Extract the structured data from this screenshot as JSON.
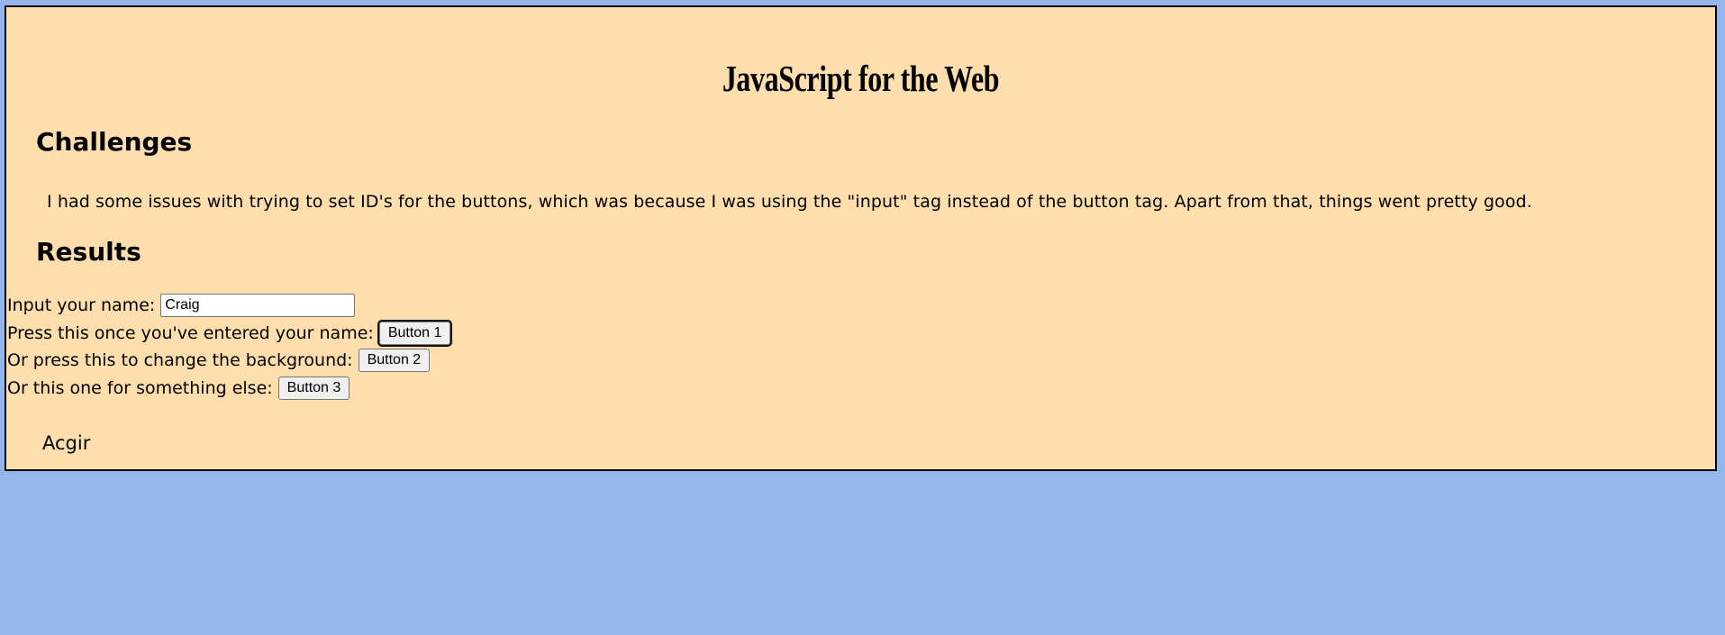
{
  "page": {
    "title": "JavaScript for the Web"
  },
  "challenges": {
    "heading": "Challenges",
    "text": "I had some issues with trying to set ID's for the buttons, which was because I was using the \"input\" tag instead of the button tag. Apart from that, things went pretty good."
  },
  "results": {
    "heading": "Results",
    "name_label": "Input your name:",
    "name_value": "Craig",
    "button1_label": "Press this once you've entered your name:",
    "button1_text": "Button 1",
    "button2_label": "Or press this to change the background:",
    "button2_text": "Button 2",
    "button3_label": "Or this one for something else:",
    "button3_text": "Button 3",
    "output": "Acgir"
  },
  "colors": {
    "page_background": "#96b5ea",
    "panel_background": "#ffdead",
    "panel_border": "#000000"
  }
}
